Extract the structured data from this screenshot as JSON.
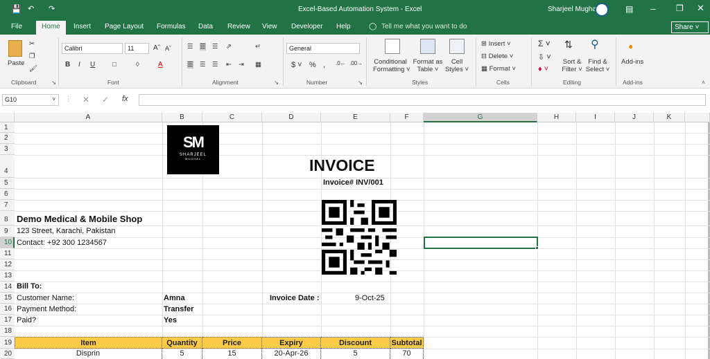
{
  "window": {
    "title": "Excel-Based Automation System  -  Excel",
    "user": "Sharjeel Mughal"
  },
  "tabs": [
    "File",
    "Home",
    "Insert",
    "Page Layout",
    "Formulas",
    "Data",
    "Review",
    "View",
    "Developer",
    "Help"
  ],
  "tell_me": "Tell me what you want to do",
  "share": "Share",
  "ribbon": {
    "paste": "Paste",
    "clipboard": "Clipboard",
    "font_name": "Calibri",
    "font_size": "11",
    "font": "Font",
    "alignment": "Alignment",
    "number_format": "General",
    "number": "Number",
    "cond_format": "Conditional",
    "cond_format2": "Formatting",
    "format_table": "Format as",
    "format_table2": "Table",
    "cell_styles": "Cell",
    "cell_styles2": "Styles",
    "styles": "Styles",
    "insert": "Insert",
    "delete": "Delete",
    "format": "Format",
    "cells": "Cells",
    "sort_filter": "Sort &",
    "sort_filter2": "Filter",
    "find_select": "Find &",
    "find_select2": "Select",
    "editing": "Editing",
    "addins": "Add-ins",
    "addins_group": "Add-ins"
  },
  "formula_bar": {
    "name_box": "G10",
    "fx": "fx",
    "value": ""
  },
  "columns": [
    "A",
    "B",
    "C",
    "D",
    "E",
    "F",
    "G",
    "H",
    "I",
    "J",
    "K"
  ],
  "rows": [
    "1",
    "2",
    "3",
    "4",
    "5",
    "6",
    "7",
    "8",
    "9",
    "10",
    "11",
    "12",
    "13",
    "14",
    "15",
    "16",
    "17",
    "18",
    "19",
    "20"
  ],
  "sheet": {
    "logo_text": "SM",
    "logo_sub": "SHARJEEL",
    "logo_sub2": "MUGHAL",
    "invoice_title": "INVOICE",
    "invoice_no": "Invoice# INV/001",
    "shop_name": "Demo Medical & Mobile Shop",
    "address": "123 Street, Karachi, Pakistan",
    "contact": "Contact: +92 300 1234567",
    "bill_to": "Bill To:",
    "customer_label": "Customer Name:",
    "customer_value": "Amna",
    "payment_label": "Payment Method:",
    "payment_value": "Transfer",
    "paid_label": "Paid?",
    "paid_value": "Yes",
    "date_label": "Invoice Date :",
    "date_value": "9-Oct-25",
    "table_headers": [
      "Item",
      "Quantity",
      "Price",
      "Expiry",
      "Discount",
      "Subtotal"
    ],
    "table_rows": [
      [
        "Disprin",
        "5",
        "15",
        "20-Apr-26",
        "5",
        "70"
      ]
    ]
  },
  "colors": {
    "excel_green": "#217346",
    "header_fill": "#fdcb47"
  }
}
